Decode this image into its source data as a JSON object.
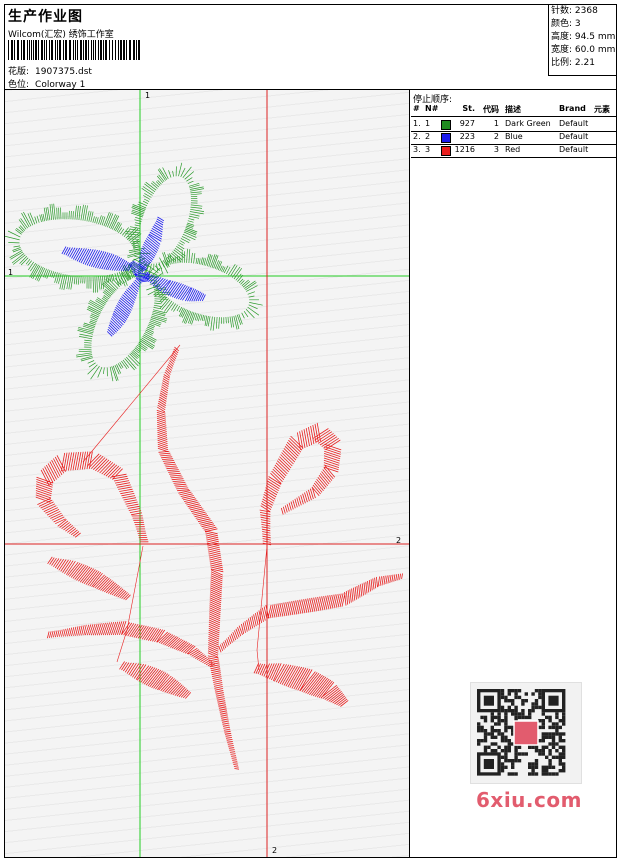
{
  "header": {
    "title": "生产作业图",
    "software": "Wilcom(汇宏) 绣饰工作室",
    "design_label": "花版:",
    "design_file": "1907375.dst",
    "colorway_label": "色位:",
    "colorway": "Colorway 1"
  },
  "stats": [
    {
      "label": "针数:",
      "value": "2368"
    },
    {
      "label": "颜色:",
      "value": "3"
    },
    {
      "label": "高度:",
      "value": "94.5 mm"
    },
    {
      "label": "宽度:",
      "value": "60.0 mm"
    },
    {
      "label": "比例:",
      "value": "2.21"
    }
  ],
  "preview": {
    "axis_top": "1",
    "axis_left": "1",
    "axis_right": "2",
    "axis_bottom": "2"
  },
  "sequence": {
    "title": "停止顺序:",
    "headers": {
      "idx": "#",
      "n": "N#",
      "st": "St.",
      "code": "代码",
      "desc": "描述",
      "brand": "Brand",
      "elem": "元素"
    },
    "rows": [
      {
        "idx": "1.",
        "n": "1",
        "color": "#1f8a1f",
        "st": "927",
        "code": "1",
        "desc": "Dark Green",
        "brand": "Default"
      },
      {
        "idx": "2.",
        "n": "2",
        "color": "#1a1aee",
        "st": "223",
        "code": "2",
        "desc": "Blue",
        "brand": "Default"
      },
      {
        "idx": "3.",
        "n": "3",
        "color": "#e81e1e",
        "st": "1216",
        "code": "3",
        "desc": "Red",
        "brand": "Default"
      }
    ]
  },
  "watermark": {
    "text": "6xiu.com"
  },
  "colors": {
    "green": "#2a9a2a",
    "blue": "#1a1aee",
    "red": "#e82020",
    "guide_green": "#22cc22",
    "guide_red": "#dd2222"
  }
}
